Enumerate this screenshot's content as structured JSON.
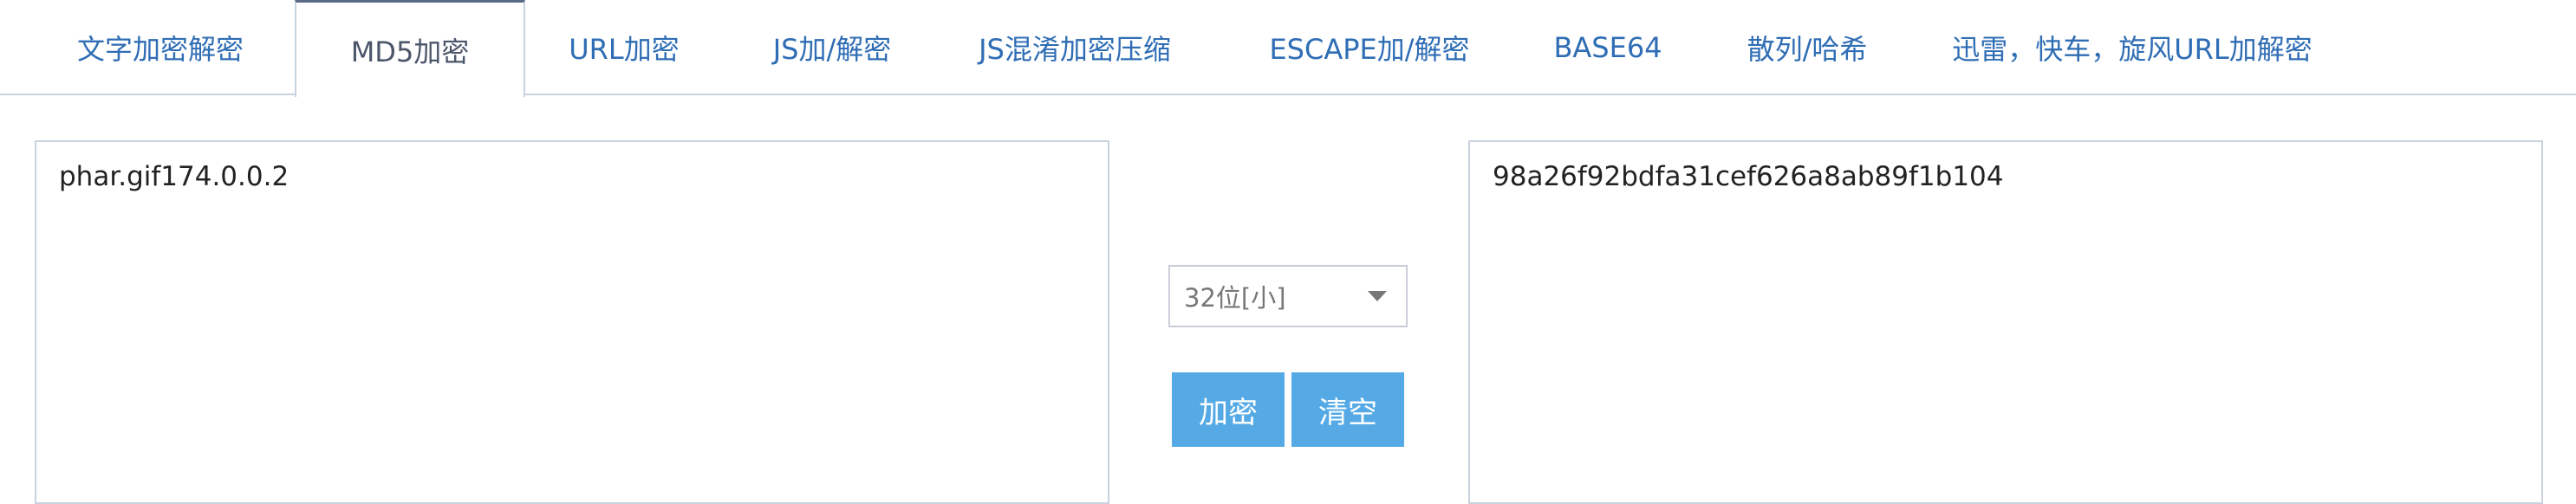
{
  "tabs": [
    {
      "label": "文字加密解密"
    },
    {
      "label": "MD5加密"
    },
    {
      "label": "URL加密"
    },
    {
      "label": "JS加/解密"
    },
    {
      "label": "JS混淆加密压缩"
    },
    {
      "label": "ESCAPE加/解密"
    },
    {
      "label": "BASE64"
    },
    {
      "label": "散列/哈希"
    },
    {
      "label": "迅雷，快车，旋风URL加解密"
    }
  ],
  "active_tab": "MD5加密",
  "input": {
    "value": "phar.gif174.0.0.2"
  },
  "mode_select": {
    "value": "32位[小]"
  },
  "buttons": {
    "encrypt_label": "加密",
    "clear_label": "清空"
  },
  "output": {
    "value": "98a26f92bdfa31cef626a8ab89f1b104"
  },
  "colors": {
    "tab_text": "#2f6db5",
    "button_bg": "#55aae6",
    "border": "#c9d3e0"
  }
}
